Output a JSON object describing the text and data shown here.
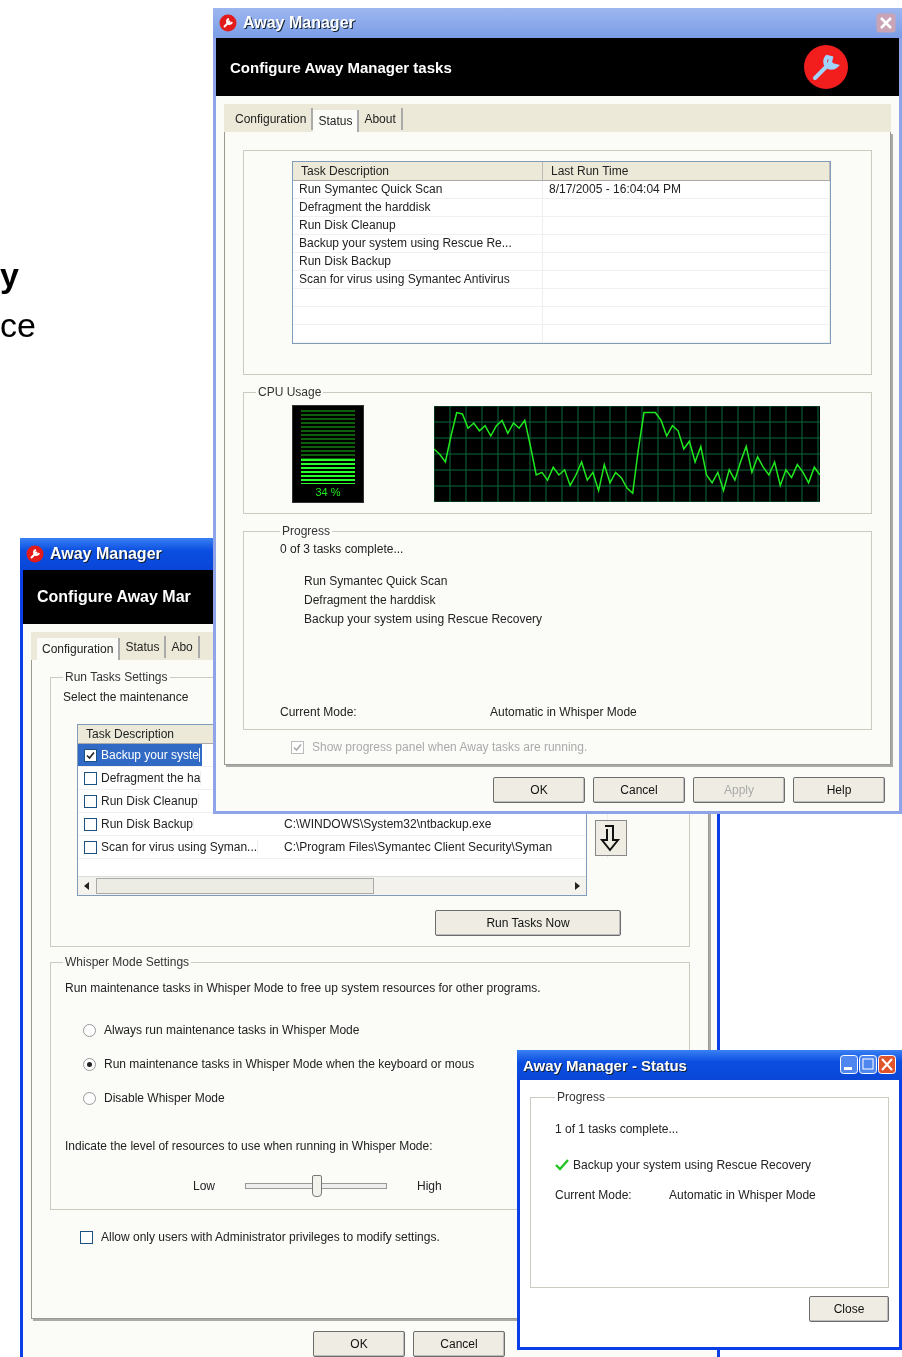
{
  "background_text": [
    {
      "text": "y",
      "bold": true
    },
    {
      "text": "ce",
      "bold": false
    }
  ],
  "config_window": {
    "title": "Away Manager",
    "header": "Configure Away Mar",
    "tabs": [
      {
        "label": "Configuration",
        "selected": true
      },
      {
        "label": "Status",
        "selected": false
      },
      {
        "label": "Abo",
        "selected": false
      }
    ],
    "run_tasks": {
      "legend": "Run Tasks Settings",
      "instruction": "Select the maintenance",
      "column": "Task Description",
      "rows": [
        {
          "task": "Backup your syste",
          "checked": true,
          "selected": true
        },
        {
          "task": "Defragment the ha",
          "checked": false,
          "selected": false
        },
        {
          "task": "Run Disk Cleanup",
          "checked": false,
          "selected": false
        },
        {
          "task": "Run Disk Backup",
          "path": "C:\\WINDOWS\\System32\\ntbackup.exe",
          "checked": false,
          "selected": false
        },
        {
          "task": "Scan for virus using Syman...",
          "path": "C:\\Program Files\\Symantec Client Security\\Syman",
          "checked": false,
          "selected": false
        }
      ],
      "run_button": "Run Tasks Now"
    },
    "whisper": {
      "legend": "Whisper Mode Settings",
      "description": "Run maintenance tasks in Whisper Mode to free up system resources for other programs.",
      "options": [
        {
          "label": "Always run maintenance tasks in Whisper Mode",
          "selected": false
        },
        {
          "label": "Run maintenance tasks in Whisper Mode when the keyboard or mous",
          "selected": true
        },
        {
          "label": "Disable Whisper Mode",
          "selected": false
        }
      ],
      "level_prompt": "Indicate the level of resources to use when running in Whisper Mode:",
      "slider": {
        "low": "Low",
        "high": "High",
        "level": 0.5
      }
    },
    "admin_option": {
      "label": "Allow only users with Administrator privileges to modify settings.",
      "checked": false
    },
    "buttons": [
      "OK",
      "Cancel"
    ]
  },
  "status_tab_window": {
    "title": "Away Manager",
    "header": "Configure Away Manager tasks",
    "tabs": [
      {
        "label": "Configuration",
        "selected": false
      },
      {
        "label": "Status",
        "selected": true
      },
      {
        "label": "About",
        "selected": false
      }
    ],
    "columns": [
      "Task Description",
      "Last Run Time"
    ],
    "rows": [
      {
        "task": "Run Symantec Quick Scan",
        "last_run": "8/17/2005 - 16:04:04 PM"
      },
      {
        "task": "Defragment the harddisk"
      },
      {
        "task": "Run Disk Cleanup"
      },
      {
        "task": "Backup your system using Rescue Re..."
      },
      {
        "task": "Run Disk Backup"
      },
      {
        "task": "Scan for virus using Symantec Antivirus"
      }
    ],
    "cpu": {
      "legend": "CPU Usage",
      "level": 0.34,
      "reading": "34 %"
    },
    "progress": {
      "legend": "Progress",
      "summary": "0 of 3 tasks complete...",
      "tasks": [
        "Run Symantec Quick Scan",
        "Defragment the harddisk",
        "Backup your system using Rescue Recovery"
      ],
      "mode_label": "Current Mode:",
      "mode_value": "Automatic in Whisper Mode"
    },
    "show_progress": {
      "label": "Show progress panel when Away tasks are running.",
      "checked": true,
      "disabled": true
    },
    "buttons": [
      {
        "label": "OK",
        "disabled": false
      },
      {
        "label": "Cancel",
        "disabled": false
      },
      {
        "label": "Apply",
        "disabled": true
      },
      {
        "label": "Help",
        "disabled": false
      }
    ]
  },
  "status_window": {
    "title": "Away Manager - Status",
    "legend": "Progress",
    "summary": "1 of 1 tasks complete...",
    "tasks": [
      {
        "label": "Backup your system using Rescue Recovery",
        "done": true
      }
    ],
    "mode_label": "Current Mode:",
    "mode_value": "Automatic in Whisper Mode",
    "button": "Close"
  }
}
